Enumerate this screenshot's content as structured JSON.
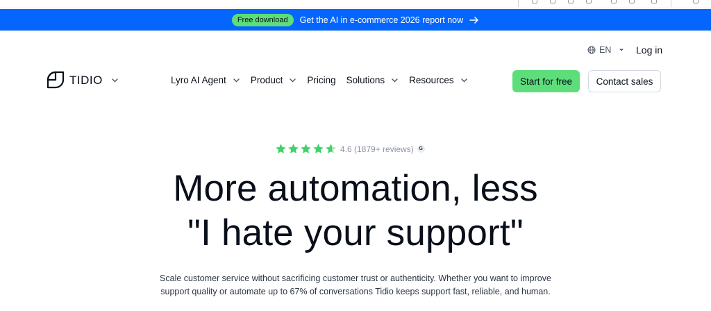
{
  "announcement": {
    "badge": "Free download",
    "message": "Get the AI in e-commerce 2026 report now",
    "arrow_icon": "arrow-right-icon",
    "background": "#0566ff",
    "badge_color": "#5dde7b"
  },
  "utility": {
    "language": "EN",
    "login": "Log in"
  },
  "header": {
    "brand": "TIDIO",
    "nav": [
      {
        "label": "Lyro AI Agent",
        "has_dropdown": true
      },
      {
        "label": "Product",
        "has_dropdown": true
      },
      {
        "label": "Pricing",
        "has_dropdown": false
      },
      {
        "label": "Solutions",
        "has_dropdown": true
      },
      {
        "label": "Resources",
        "has_dropdown": true
      }
    ],
    "cta_primary": "Start for free",
    "cta_secondary": "Contact sales",
    "accent": "#5dde7b"
  },
  "rating": {
    "stars": 4.6,
    "text": "4.6 (1879+ reviews)",
    "badge_letter": "G"
  },
  "hero": {
    "headline_line1": "More automation, less",
    "headline_line2": "\"I hate your support\"",
    "subtext_line1": "Scale customer service without sacrificing customer trust or authenticity. Whether you want to improve",
    "subtext_line2": "support quality or automate up to 67% of conversations Tidio keeps support fast, reliable, and human."
  }
}
